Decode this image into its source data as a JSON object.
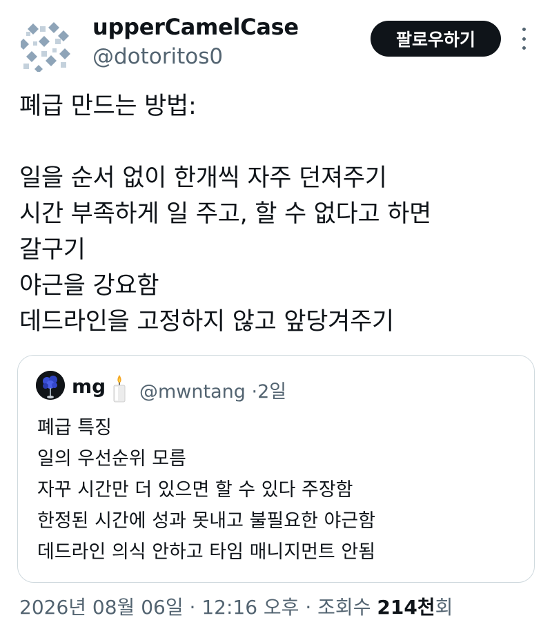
{
  "author": {
    "display_name": "upperCamelCase",
    "handle": "@dotoritos0",
    "follow_label": "팔로우하기"
  },
  "tweet": {
    "lines": [
      "폐급 만드는 방법:",
      "",
      "일을 순서 없이 한개씩 자주 던져주기",
      "시간 부족하게 일 주고, 할 수 없다고 하면",
      "갈구기",
      "야근을 강요함",
      "데드라인을 고정하지 않고 앞당겨주기"
    ]
  },
  "quote": {
    "display_name": "mg",
    "handle": "@mwntang",
    "separator": "·",
    "time": "2일",
    "lines": [
      "폐급 특징",
      "일의 우선순위 모름",
      "자꾸 시간만 더 있으면 할 수 있다 주장함",
      "한정된 시간에 성과 못내고 불필요한 야근함",
      "데드라인 의식 안하고 타임 매니지먼트 안됨"
    ]
  },
  "footer": {
    "date": "2026년 08월 06일",
    "separator": "·",
    "time": "12:16 오후",
    "views_label": "조회수",
    "views_count": "214천",
    "views_suffix": "회"
  },
  "icons": {
    "avatar": "pixel-pattern-avatar",
    "more": "more-vertical-icon",
    "quote_avatar": "blue-rose-avatar",
    "candle": "candle-icon"
  }
}
